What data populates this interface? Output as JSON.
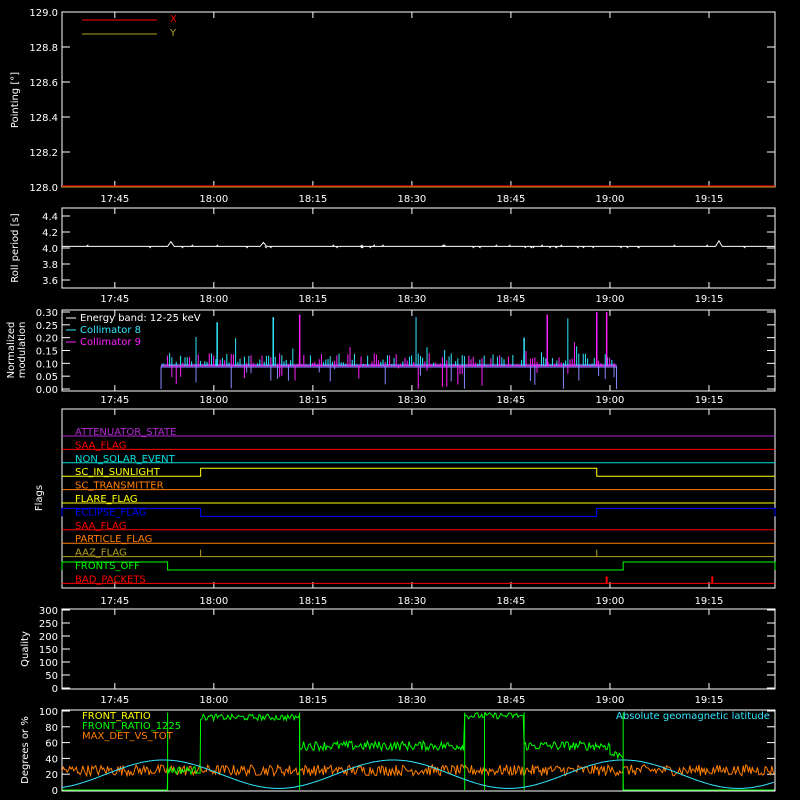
{
  "colors": {
    "background": "#000000",
    "axis": "#ffffff",
    "red": "#ff0000",
    "olive": "#b4a020",
    "white": "#ffffff",
    "cyan": "#33e6ff",
    "magenta": "#ff22ff",
    "purple": "#b027d0",
    "teal": "#00e0e0",
    "orange": "#ff7f00",
    "yellow": "#ffff00",
    "blue": "#0000ff",
    "green": "#00ff00",
    "lightblue": "#8888ff"
  },
  "time_ticks": [
    "17:45",
    "18:00",
    "18:15",
    "18:30",
    "18:45",
    "19:00",
    "19:15"
  ],
  "chart_data": [
    {
      "type": "line",
      "panel": "pointing",
      "ylabel": "Pointing [°]",
      "ylim": [
        128.0,
        129.0
      ],
      "yticks": [
        "129.0",
        "128.8",
        "128.6",
        "128.4",
        "128.2",
        "128.0"
      ],
      "legend": [
        "X",
        "Y"
      ],
      "series": [
        {
          "name": "X",
          "color": "red",
          "x": [
            "17:37",
            "19:25"
          ],
          "values": [
            128.0,
            128.0
          ]
        },
        {
          "name": "Y",
          "color": "olive",
          "x": [
            "17:37",
            "19:25"
          ],
          "values": [
            128.0,
            128.0
          ]
        }
      ]
    },
    {
      "type": "line",
      "panel": "roll",
      "ylabel": "Roll period [s]",
      "ylim": [
        3.5,
        4.5
      ],
      "yticks": [
        "4.4",
        "4.2",
        "4.0",
        "3.8",
        "3.6"
      ],
      "series": [
        {
          "name": "",
          "color": "white",
          "x": [
            "17:37",
            "17:53",
            "17:53.5",
            "17:54",
            "18:07",
            "18:07.5",
            "18:08",
            "19:16",
            "19:16.5",
            "19:17",
            "19:25"
          ],
          "values": [
            4.02,
            4.02,
            4.08,
            4.02,
            4.02,
            4.07,
            4.02,
            4.02,
            4.09,
            4.02,
            4.02
          ]
        }
      ]
    },
    {
      "type": "line",
      "panel": "modulation",
      "ylabel": "Normalized modulation",
      "ylim": [
        0.0,
        0.3
      ],
      "yticks": [
        "0.30",
        "0.25",
        "0.20",
        "0.15",
        "0.10",
        "0.05",
        "0.00"
      ],
      "legend": [
        "Energy band: 12-25 keV",
        "Collimator 8",
        "Collimator 9"
      ],
      "time_range": [
        "17:52",
        "19:01"
      ],
      "baseline": 0.09,
      "series": [
        {
          "name": "Collimator 8",
          "color": "cyan"
        },
        {
          "name": "Collimator 9",
          "color": "magenta"
        }
      ]
    },
    {
      "type": "line",
      "panel": "flags",
      "ylabel": "Flags",
      "flags": [
        {
          "label": "ATTENUATOR_STATE",
          "color": "purple",
          "segments": []
        },
        {
          "label": "SAA_FLAG",
          "color": "red",
          "segments": []
        },
        {
          "label": "NON_SOLAR_EVENT",
          "color": "teal",
          "segments": []
        },
        {
          "label": "SC_IN_SUNLIGHT",
          "color": "yellow",
          "segments": [
            [
              "17:58",
              "18:58"
            ]
          ]
        },
        {
          "label": "SC_TRANSMITTER",
          "color": "orange",
          "segments": []
        },
        {
          "label": "FLARE_FLAG",
          "color": "yellow",
          "segments": []
        },
        {
          "label": "ECLIPSE_FLAG",
          "color": "blue",
          "segments": [
            [
              "17:37",
              "17:58"
            ],
            [
              "18:58",
              "19:25"
            ]
          ]
        },
        {
          "label": "SAA_FLAG",
          "color": "red",
          "segments": []
        },
        {
          "label": "PARTICLE_FLAG",
          "color": "orange",
          "segments": []
        },
        {
          "label": "AAZ_FLAG",
          "color": "olive",
          "spikes": [
            "17:58",
            "18:58"
          ]
        },
        {
          "label": "FRONTS_OFF",
          "color": "green",
          "segments": [
            [
              "17:37",
              "17:53"
            ],
            [
              "19:02",
              "19:25"
            ]
          ]
        },
        {
          "label": "BAD_PACKETS",
          "color": "red",
          "spikes": [
            "18:59.5",
            "19:15.5"
          ]
        }
      ]
    },
    {
      "type": "line",
      "panel": "quality",
      "ylabel": "Quality",
      "ylim": [
        0,
        300
      ],
      "yticks": [
        "300",
        "250",
        "200",
        "150",
        "100",
        "50",
        "0"
      ],
      "series": []
    },
    {
      "type": "line",
      "panel": "ratios",
      "ylabel": "Degrees or %",
      "ylim": [
        0,
        100
      ],
      "yticks": [
        "100",
        "80",
        "60",
        "40",
        "20",
        "0"
      ],
      "legend": [
        "FRONT_RATIO",
        "FRONT_RATIO_1225",
        "MAX_DET_VS_TOT"
      ],
      "annotation": "Absolute geomagnetic latitude",
      "series": [
        {
          "name": "FRONT_RATIO",
          "color": "green"
        },
        {
          "name": "FRONT_RATIO_1225",
          "color": "green"
        },
        {
          "name": "MAX_DET_VS_TOT",
          "color": "orange"
        },
        {
          "name": "Absolute geomagnetic latitude",
          "color": "cyan"
        }
      ]
    }
  ]
}
